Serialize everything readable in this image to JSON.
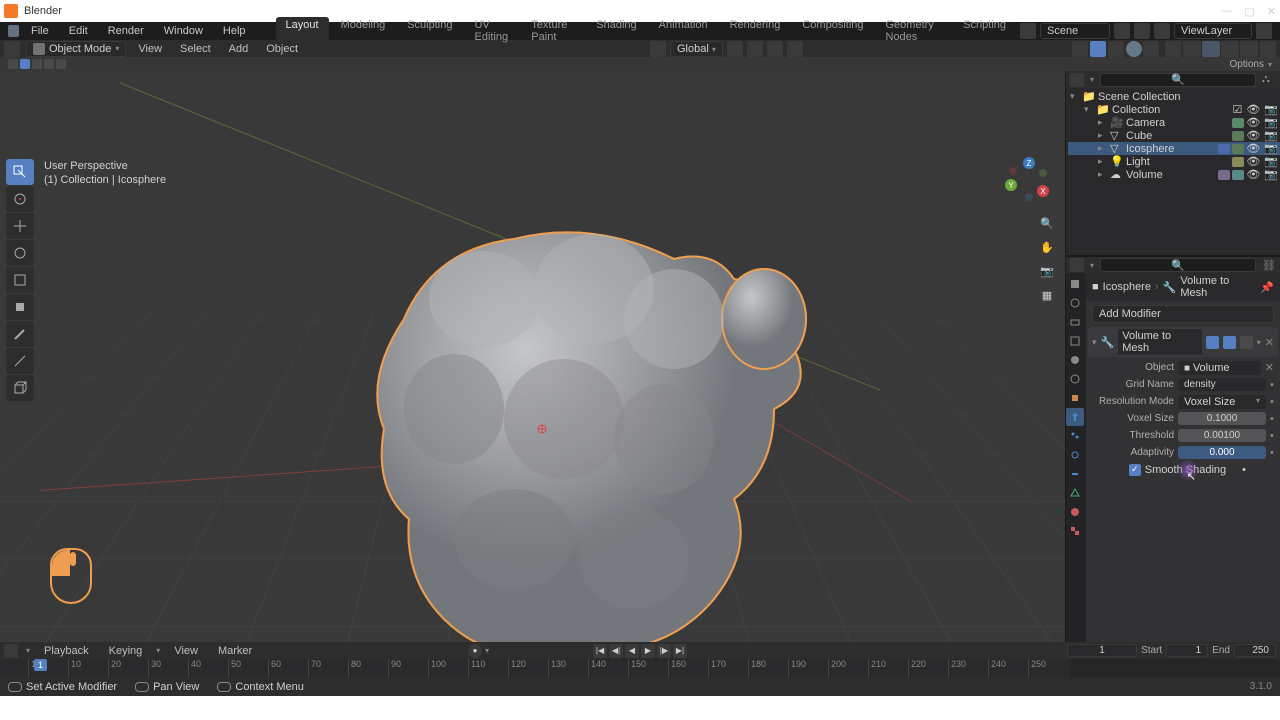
{
  "titlebar": {
    "title": "Blender"
  },
  "menubar": {
    "items": [
      "File",
      "Edit",
      "Render",
      "Window",
      "Help"
    ],
    "tabs": [
      "Layout",
      "Modeling",
      "Sculpting",
      "UV Editing",
      "Texture Paint",
      "Shading",
      "Animation",
      "Rendering",
      "Compositing",
      "Geometry Nodes",
      "Scripting"
    ],
    "active_tab": 0,
    "scene": "Scene",
    "viewlayer": "ViewLayer"
  },
  "toolbar": {
    "mode": "Object Mode",
    "menus": [
      "View",
      "Select",
      "Add",
      "Object"
    ],
    "orientation": "Global",
    "options": "Options"
  },
  "viewport": {
    "perspective": "User Perspective",
    "collection": "(1) Collection | Icosphere"
  },
  "outliner": {
    "root": "Scene Collection",
    "collection": "Collection",
    "items": [
      {
        "name": "Camera",
        "type": "camera"
      },
      {
        "name": "Cube",
        "type": "mesh"
      },
      {
        "name": "Icosphere",
        "type": "mesh",
        "selected": true
      },
      {
        "name": "Light",
        "type": "light"
      },
      {
        "name": "Volume",
        "type": "volume"
      }
    ]
  },
  "properties": {
    "breadcrumb_obj": "Icosphere",
    "breadcrumb_mod": "Volume to Mesh",
    "add_modifier": "Add Modifier",
    "modifier": {
      "name": "Volume to Mesh",
      "object_label": "Object",
      "object_value": "Volume",
      "grid_label": "Grid Name",
      "grid_value": "density",
      "resmode_label": "Resolution Mode",
      "resmode_value": "Voxel Size",
      "voxel_label": "Voxel Size",
      "voxel_value": "0.1000",
      "threshold_label": "Threshold",
      "threshold_value": "0.00100",
      "adapt_label": "Adaptivity",
      "adapt_value": "0.000",
      "smooth_label": "Smooth Shading"
    }
  },
  "timeline": {
    "menus": [
      "Playback",
      "Keying",
      "View",
      "Marker"
    ],
    "current": "1",
    "start_label": "Start",
    "start": "1",
    "end_label": "End",
    "end": "250",
    "ticks": [
      "1",
      "10",
      "20",
      "30",
      "40",
      "50",
      "60",
      "70",
      "80",
      "90",
      "100",
      "110",
      "120",
      "130",
      "140",
      "150",
      "160",
      "170",
      "180",
      "190",
      "200",
      "210",
      "220",
      "230",
      "240",
      "250"
    ]
  },
  "statusbar": {
    "items": [
      "Set Active Modifier",
      "Pan View",
      "Context Menu"
    ],
    "version": "3.1.0"
  }
}
